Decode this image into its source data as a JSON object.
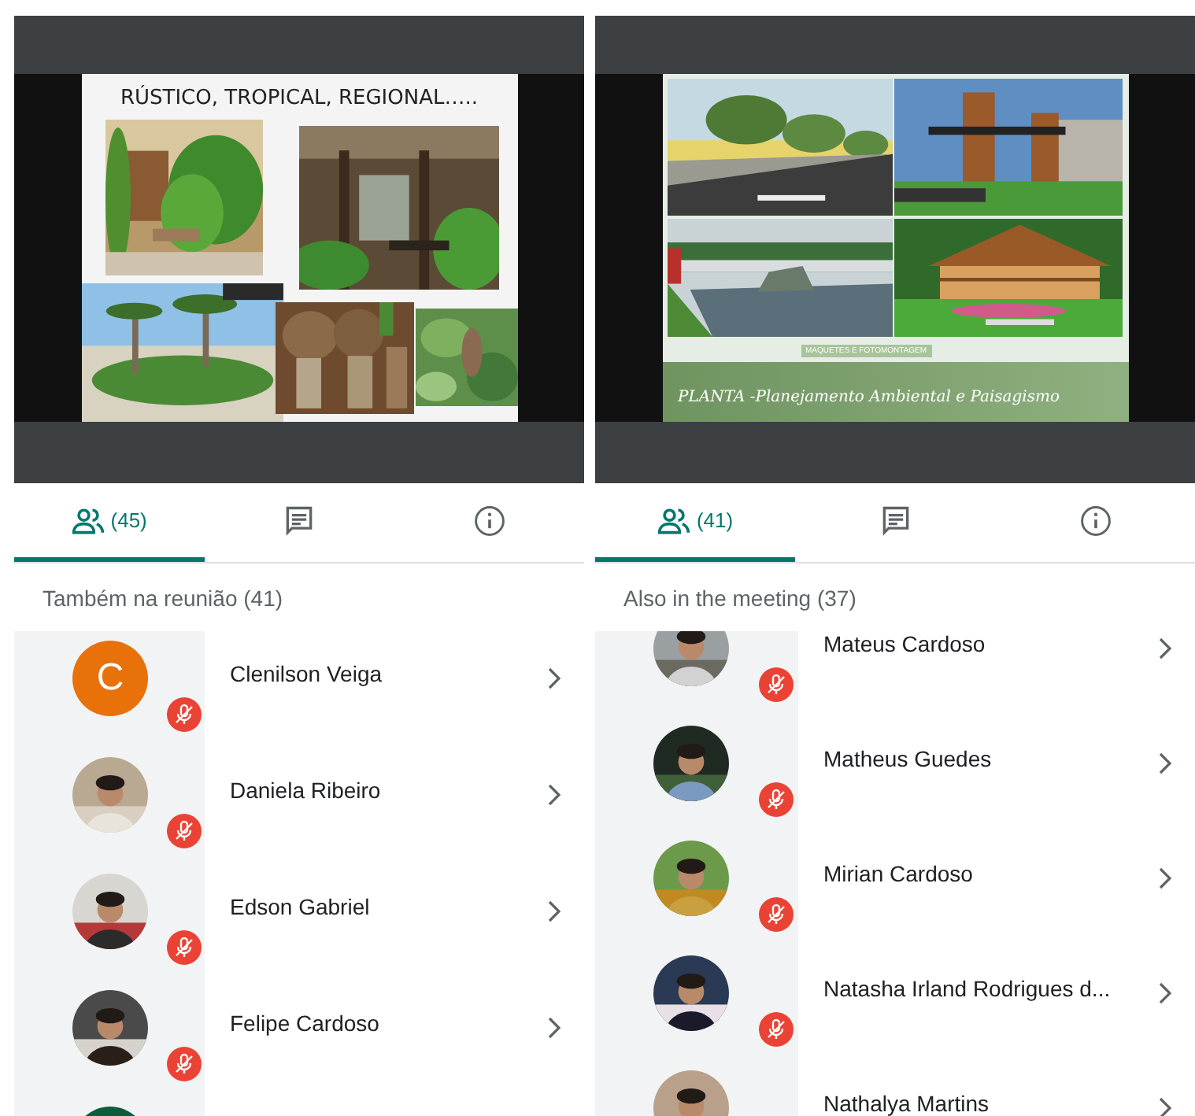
{
  "panels": [
    {
      "slide": {
        "kind": "collage",
        "title": "RÚSTICO, TROPICAL, REGIONAL….."
      },
      "tabs": [
        {
          "kind": "people",
          "count": "(45)",
          "selected": true
        },
        {
          "kind": "chat",
          "selected": false
        },
        {
          "kind": "info",
          "selected": false
        }
      ],
      "heading": "Também na reunião (41)",
      "participants": [
        {
          "kind": "letter",
          "initial": "C",
          "color": "#e8710a",
          "name": "Clenilson Veiga",
          "muted": true
        },
        {
          "name": "Daniela Ribeiro",
          "muted": true
        },
        {
          "name": "Edson Gabriel",
          "muted": true
        },
        {
          "name": "Felipe Cardoso",
          "muted": true
        },
        {
          "kind": "blank",
          "color": "#0d5c3a"
        }
      ]
    },
    {
      "slide": {
        "kind": "banner",
        "caption": "MAQUETES E FOTOMONTAGEM",
        "footer": "PLANTA -Planejamento Ambiental e Paisagismo"
      },
      "tabs": [
        {
          "kind": "people",
          "count": "(41)",
          "selected": true
        },
        {
          "kind": "chat",
          "selected": false
        },
        {
          "kind": "info",
          "selected": false
        }
      ],
      "heading": "Also in the meeting (37)",
      "participants": [
        {
          "name": "Mateus Cardoso",
          "muted": true
        },
        {
          "name": "Matheus Guedes",
          "muted": true
        },
        {
          "name": "Mirian Cardoso",
          "muted": true
        },
        {
          "name": "Natasha Irland Rodrigues d...",
          "muted": true
        },
        {
          "name": "Nathalya Martins"
        }
      ]
    }
  ]
}
